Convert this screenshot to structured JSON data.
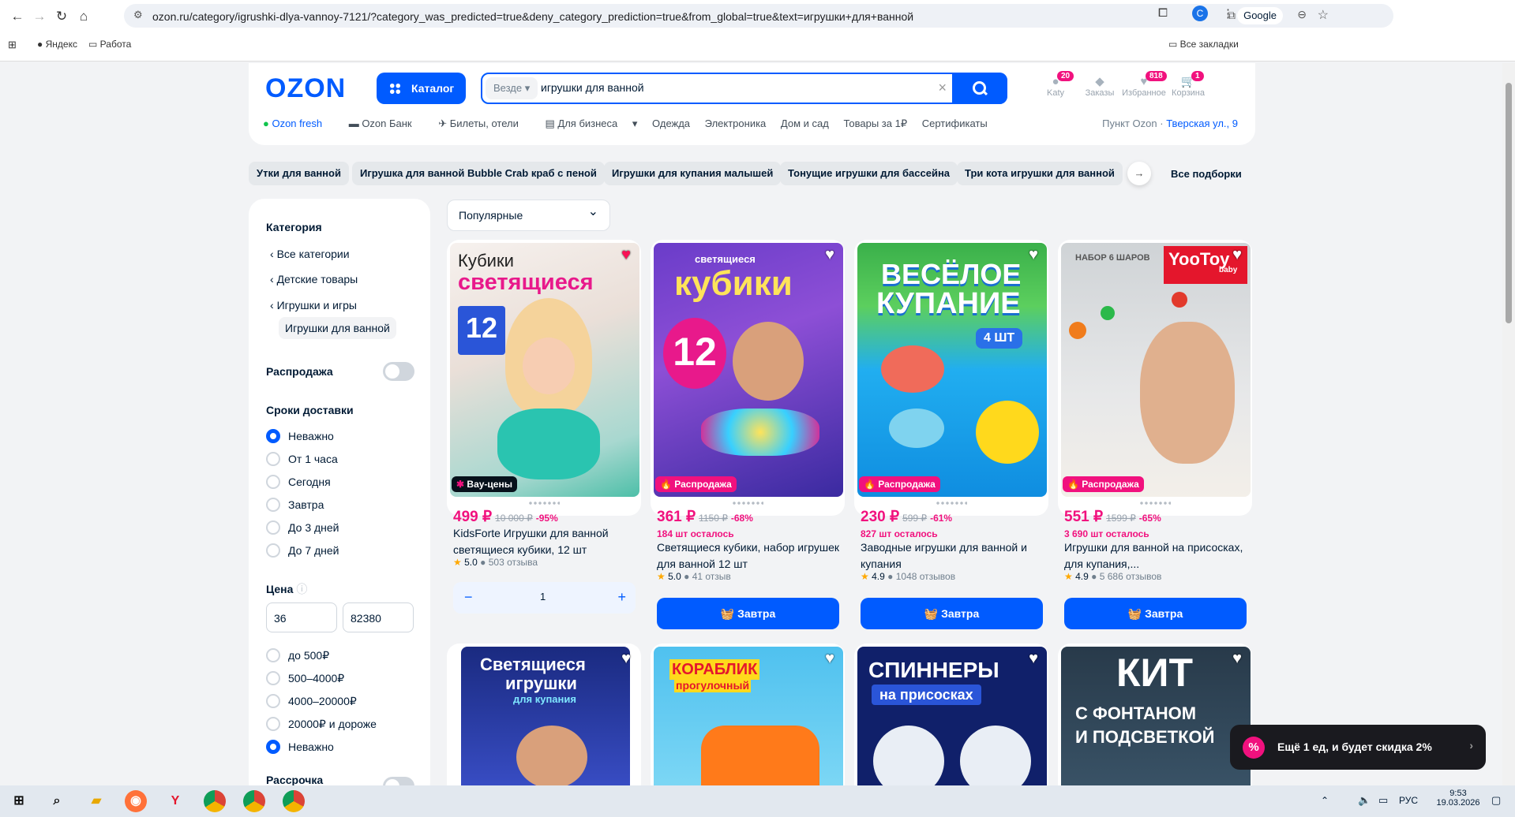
{
  "browser": {
    "url": "ozon.ru/category/igrushki-dlya-vannoy-7121/?category_was_predicted=true&deny_category_prediction=true&from_global=true&text=игрушки+для+ванной",
    "search_engine": "Google",
    "profile": "C",
    "bookmarks": [
      "Яндекс",
      "Работа"
    ],
    "all_bookmarks": "Все закладки"
  },
  "header": {
    "logo": "OZON",
    "catalog": "Каталог",
    "search_scope": "Везде",
    "search_value": "игрушки для ванной",
    "icons": [
      {
        "label": "Katy",
        "count": "20"
      },
      {
        "label": "Заказы",
        "count": ""
      },
      {
        "label": "Избранное",
        "count": "818"
      },
      {
        "label": "Корзина",
        "count": "1"
      }
    ],
    "sublinks": [
      "Ozon fresh",
      "Ozon Банк",
      "Билеты, отели",
      "Для бизнеса",
      "Одежда",
      "Электроника",
      "Дом и сад",
      "Товары за 1₽",
      "Сертификаты"
    ],
    "pickup_label": "Пункт Ozon ·",
    "pickup_address": "Тверская ул., 9"
  },
  "chips": [
    "Утки для ванной",
    "Игрушка для ванной Bubble Crab краб с пеной",
    "Игрушки для купания малышей",
    "Тонущие игрушки для бассейна",
    "Три кота игрушки для ванной"
  ],
  "all_selections": "Все подборки",
  "sidebar": {
    "category_title": "Категория",
    "categories": [
      "Все категории",
      "Детские товары",
      "Игрушки и игры"
    ],
    "current": "Игрушки для ванной",
    "sale": "Распродажа",
    "delivery_title": "Сроки доставки",
    "delivery": [
      "Неважно",
      "От 1 часа",
      "Сегодня",
      "Завтра",
      "До 3 дней",
      "До 7 дней"
    ],
    "price_title": "Цена",
    "price_from": "36",
    "price_to": "82380",
    "price_ranges": [
      "до 500₽",
      "500–4000₽",
      "4000–20000₽",
      "20000₽ и дороже",
      "Неважно"
    ],
    "installment": "Рассрочка"
  },
  "sort": "Популярные",
  "products": [
    {
      "price": "499 ₽",
      "old": "10 000 ₽",
      "discount": "-95%",
      "left": "",
      "title": "KidsForte Игрушки для ванной светящиеся кубики, 12 шт",
      "rating": "5.0",
      "reviews": "503 отзыва",
      "badge": "Вау-цены",
      "img_top": "Кубики",
      "img_main": "светящиеся",
      "img_num": "12",
      "qty": "1"
    },
    {
      "price": "361 ₽",
      "old": "1150 ₽",
      "discount": "-68%",
      "left": "184 шт осталось",
      "title": "Светящиеся кубики, набор игрушек для ванной 12 шт",
      "rating": "5.0",
      "reviews": "41 отзыв",
      "badge": "Распродажа",
      "img_top": "светящиеся",
      "img_main": "кубики",
      "img_num": "12",
      "button": "Завтра"
    },
    {
      "price": "230 ₽",
      "old": "599 ₽",
      "discount": "-61%",
      "left": "827 шт осталось",
      "title": "Заводные игрушки для ванной и купания",
      "rating": "4.9",
      "reviews": "1048 отзывов",
      "badge": "Распродажа",
      "img_top": "ВЕСЁЛОЕ",
      "img_main": "КУПАНИЕ",
      "img_num": "4 ШТ",
      "button": "Завтра"
    },
    {
      "price": "551 ₽",
      "old": "1599 ₽",
      "discount": "-65%",
      "left": "3 690 шт осталось",
      "title": "Игрушки для ванной на присосках, для купания,...",
      "rating": "4.9",
      "reviews": "5 686 отзывов",
      "badge": "Распродажа",
      "img_top": "НАБОР 6 ШАРОВ",
      "img_main": "YooToy",
      "img_num": "baby",
      "button": "Завтра"
    }
  ],
  "row2": [
    {
      "line1": "Светящиеся",
      "line2": "игрушки",
      "line3": "для купания"
    },
    {
      "line1": "КОРАБЛИК",
      "line2": "прогулочный",
      "line3": ""
    },
    {
      "line1": "СПИННЕРЫ",
      "line2": "на присосках",
      "line3": ""
    },
    {
      "line1": "КИТ",
      "line2": "С ФОНТАНОМ",
      "line3": "И ПОДСВЕТКОЙ"
    }
  ],
  "toast": "Ещё 1 ед, и будет скидка 2%",
  "clock": {
    "time": "9:53",
    "date": "19.03.2026",
    "lang": "РУС"
  }
}
